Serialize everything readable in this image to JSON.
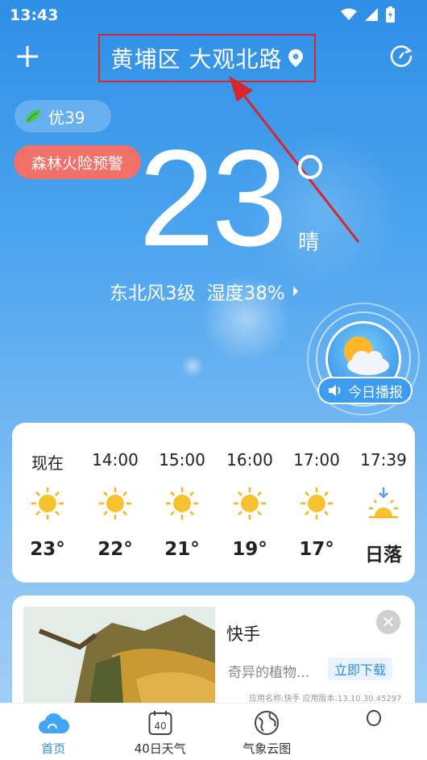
{
  "status_bar": {
    "time": "13:43"
  },
  "header": {
    "location": "黄埔区 大观北路"
  },
  "aqi": {
    "label": "优39"
  },
  "warning": {
    "label": "森林火险预警"
  },
  "current": {
    "temperature": "23",
    "condition": "晴",
    "wind": "东北风3级",
    "humidity": "湿度38%"
  },
  "broadcast": {
    "label": "今日播报"
  },
  "hourly": [
    {
      "time": "现在",
      "temp": "23°",
      "icon": "sun-icon"
    },
    {
      "time": "14:00",
      "temp": "22°",
      "icon": "sun-icon"
    },
    {
      "time": "15:00",
      "temp": "21°",
      "icon": "sun-icon"
    },
    {
      "time": "16:00",
      "temp": "19°",
      "icon": "sun-icon"
    },
    {
      "time": "17:00",
      "temp": "17°",
      "icon": "sun-icon"
    },
    {
      "time": "17:39",
      "temp": "日落",
      "icon": "sunset-icon"
    }
  ],
  "ad": {
    "title": "快手",
    "description": "奇异的植物...",
    "download": "立即下载",
    "meta": "应用名称:快手   应用版本:13.10.30.45297"
  },
  "nav": [
    {
      "label": "首页",
      "icon": "cloud-icon",
      "active": true
    },
    {
      "label": "40日天气",
      "icon": "calendar-40-icon",
      "active": false
    },
    {
      "label": "气象云图",
      "icon": "globe-icon",
      "active": false
    },
    {
      "label": "",
      "icon": "profile-icon",
      "active": false
    }
  ],
  "colors": {
    "accent": "#2f8fe6",
    "warning": "#f2706a",
    "annotation": "#d8262f"
  }
}
